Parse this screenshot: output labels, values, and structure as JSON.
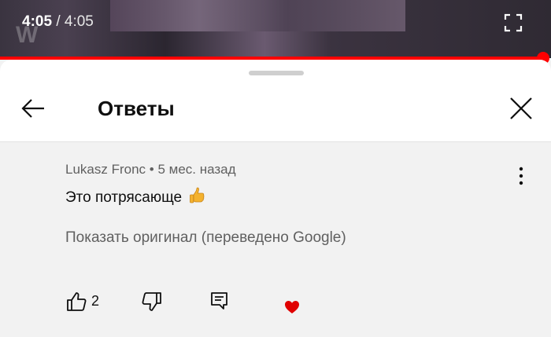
{
  "player": {
    "current_time": "4:05",
    "separator": "/",
    "duration": "4:05",
    "progress_fraction": 1.0,
    "fullscreen_icon": "fullscreen-icon",
    "accent_color": "#ff0000"
  },
  "sheet": {
    "title": "Ответы",
    "back_icon": "arrow-left-icon",
    "close_icon": "close-icon"
  },
  "comment": {
    "author": "Lukasz Fronc",
    "dot": "•",
    "age": "5 мес. назад",
    "text": "Это потрясающе",
    "emoji_icon": "thumbs-up-emoji",
    "translate_label": "Показать оригинал (переведено Google)",
    "more_icon": "more-vertical-icon",
    "like_count": "2",
    "like_icon": "thumb-up-icon",
    "dislike_icon": "thumb-down-icon",
    "reply_icon": "reply-icon",
    "heart_icon": "heart-icon",
    "heart_color": "#e00000"
  }
}
